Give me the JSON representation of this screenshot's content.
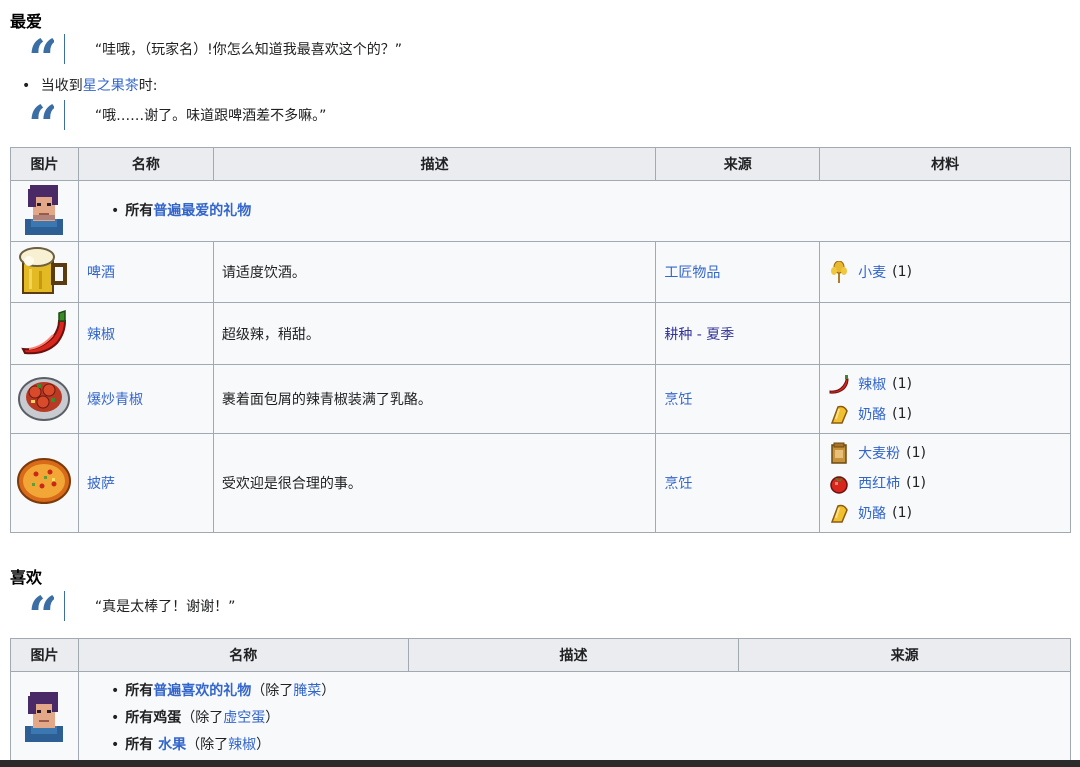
{
  "love": {
    "heading": "最爱",
    "quote1": "“哇哦，（玩家名）!你怎么知道我最喜欢这个的？”",
    "bullet_prefix": "当收到",
    "bullet_link": "星之果茶",
    "bullet_suffix": "时:",
    "quote2": "“哦……谢了。味道跟啤酒差不多嘛。”",
    "table": {
      "headers": [
        "图片",
        "名称",
        "描述",
        "来源",
        "材料"
      ],
      "universal_prefix": "所有",
      "universal_link": "普遍最爱的礼物",
      "rows": [
        {
          "name": "啤酒",
          "desc": "请适度饮酒。",
          "source": "工匠物品",
          "source2": "",
          "materials": [
            {
              "icon": "wheat-icon",
              "name": "小麦",
              "qty": "(1)"
            }
          ]
        },
        {
          "name": "辣椒",
          "desc": "超级辣，稍甜。",
          "source": "耕种 - ",
          "source2": "夏季",
          "materials": []
        },
        {
          "name": "爆炒青椒",
          "desc": "裹着面包屑的辣青椒装满了乳酪。",
          "source": "烹饪",
          "source2": "",
          "materials": [
            {
              "icon": "hot-pepper-icon",
              "name": "辣椒",
              "qty": "(1)"
            },
            {
              "icon": "cheese-icon",
              "name": "奶酪",
              "qty": "(1)"
            }
          ]
        },
        {
          "name": "披萨",
          "desc": "受欢迎是很合理的事。",
          "source": "烹饪",
          "source2": "",
          "materials": [
            {
              "icon": "wheat-flour-icon",
              "name": "大麦粉",
              "qty": "(1)"
            },
            {
              "icon": "tomato-icon",
              "name": "西红柿",
              "qty": "(1)"
            },
            {
              "icon": "cheese-icon",
              "name": "奶酪",
              "qty": "(1)"
            }
          ]
        }
      ]
    }
  },
  "like": {
    "heading": "喜欢",
    "quote": "“真是太棒了！谢谢！”",
    "table": {
      "headers": [
        "图片",
        "名称",
        "描述",
        "来源"
      ],
      "items": [
        {
          "prefix": "所有",
          "link": "普遍喜欢的礼物",
          "paren_open": "（除了",
          "paren_link": "腌菜",
          "paren_close": "）"
        },
        {
          "prefix": "所有鸡蛋",
          "link": "",
          "paren_open": "（除了",
          "paren_link": "虚空蛋",
          "paren_close": "）"
        },
        {
          "prefix": "所有 ",
          "link": "水果",
          "paren_open": "（除了",
          "paren_link": "辣椒",
          "paren_close": "）"
        }
      ]
    }
  }
}
